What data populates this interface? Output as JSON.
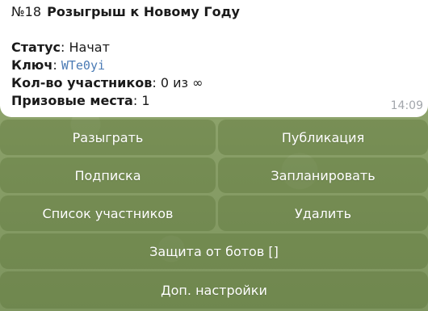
{
  "message": {
    "number": "№18",
    "title": "Розыгрыш к Новому Году",
    "status_label": "Статус",
    "status_value": "Начат",
    "key_label": "Ключ",
    "key_value": "WTe0yi",
    "participants_label": "Кол-во участников",
    "participants_value": "0 из ∞",
    "prizes_label": "Призовые места",
    "prizes_value": "1",
    "time": "14:09"
  },
  "buttons": {
    "draw": "Разыграть",
    "publish": "Публикация",
    "subscription": "Подписка",
    "schedule": "Запланировать",
    "participants_list": "Список участников",
    "delete": "Удалить",
    "bot_protection": "Защита от ботов []",
    "extra_settings": "Доп. настройки"
  }
}
